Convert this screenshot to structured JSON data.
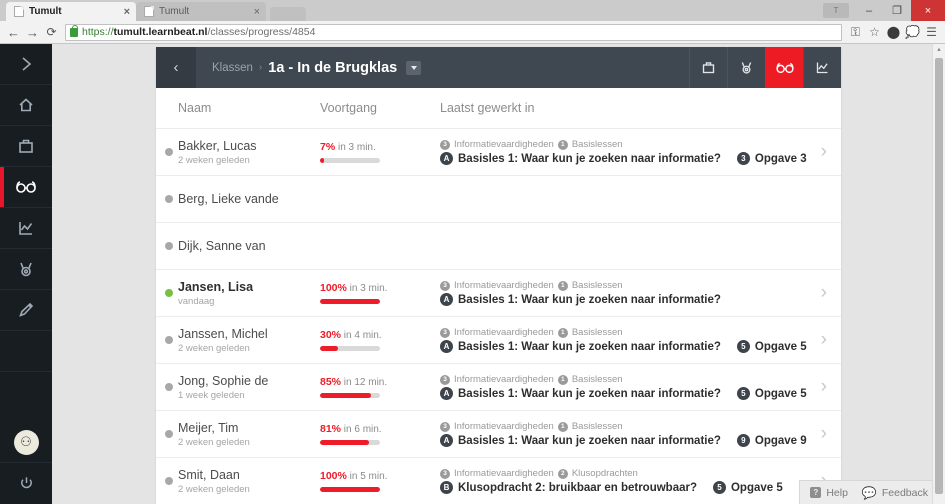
{
  "browser": {
    "tabs": [
      {
        "title": "Tumult",
        "active": true,
        "close": "×"
      },
      {
        "title": "Tumult",
        "active": false,
        "close": "×"
      }
    ],
    "window_controls": {
      "extension": "T",
      "minimize": "–",
      "maximize": "❐",
      "close": "×"
    },
    "nav": {
      "back": "←",
      "forward": "→",
      "reload": "⟳"
    },
    "url": {
      "scheme": "https://",
      "host": "tumult.learnbeat.nl",
      "path": "/classes/progress/4854"
    },
    "toolbar_icons": [
      "key-icon",
      "star-icon",
      "pocket-icon",
      "evernote-icon",
      "menu-icon"
    ]
  },
  "rail": {
    "items": [
      {
        "name": "expand-rail",
        "icon": "chevron-right-icon",
        "active": false
      },
      {
        "name": "home",
        "icon": "home-icon",
        "active": false
      },
      {
        "name": "classes",
        "icon": "briefcase-icon",
        "active": false
      },
      {
        "name": "progress",
        "icon": "glasses-icon",
        "active": true
      },
      {
        "name": "statistics",
        "icon": "chart-line-icon",
        "active": false
      },
      {
        "name": "awards",
        "icon": "medal-icon",
        "active": false
      },
      {
        "name": "editor",
        "icon": "pencil-icon",
        "active": false
      }
    ],
    "avatar_label": "⚇",
    "logout_icon": "power-icon"
  },
  "header": {
    "back_icon": "‹",
    "breadcrumb_parent": "Klassen",
    "breadcrumb_separator": "›",
    "breadcrumb_current": "1a - In de Brugklas",
    "tools": [
      {
        "name": "briefcase-icon",
        "active": false
      },
      {
        "name": "medal-icon",
        "active": false
      },
      {
        "name": "glasses-icon",
        "active": true
      },
      {
        "name": "chart-line-icon",
        "active": false
      }
    ]
  },
  "table": {
    "columns": {
      "name": "Naam",
      "progress": "Voortgang",
      "last": "Laatst gewerkt in"
    },
    "rows": [
      {
        "name": "Bakker, Lucas",
        "when": "2 weken geleden",
        "status": "grey",
        "percent": "7%",
        "percent_value": 7,
        "duration": "in 3 min.",
        "chapter_badge": "3",
        "chapter": "Informatievaardigheden",
        "section_badge": "1",
        "section": "Basislessen",
        "lesson_badge": "A",
        "lesson": "Basisles 1: Waar kun je zoeken naar informatie?",
        "task_badge": "3",
        "task": "Opgave 3",
        "highlight": false
      },
      {
        "name": "Berg, Lieke vande",
        "when": "",
        "status": "grey",
        "percent": "",
        "percent_value": 0,
        "duration": "",
        "chapter_badge": "",
        "chapter": "",
        "section_badge": "",
        "section": "",
        "lesson_badge": "",
        "lesson": "",
        "task_badge": "",
        "task": "",
        "highlight": false
      },
      {
        "name": "Dijk, Sanne van",
        "when": "",
        "status": "grey",
        "percent": "",
        "percent_value": 0,
        "duration": "",
        "chapter_badge": "",
        "chapter": "",
        "section_badge": "",
        "section": "",
        "lesson_badge": "",
        "lesson": "",
        "task_badge": "",
        "task": "",
        "highlight": false
      },
      {
        "name": "Jansen, Lisa",
        "when": "vandaag",
        "status": "green",
        "percent": "100%",
        "percent_value": 100,
        "duration": "in 3 min.",
        "chapter_badge": "3",
        "chapter": "Informatievaardigheden",
        "section_badge": "1",
        "section": "Basislessen",
        "lesson_badge": "A",
        "lesson": "Basisles 1: Waar kun je zoeken naar informatie?",
        "task_badge": "",
        "task": "",
        "highlight": true
      },
      {
        "name": "Janssen, Michel",
        "when": "2 weken geleden",
        "status": "grey",
        "percent": "30%",
        "percent_value": 30,
        "duration": "in 4 min.",
        "chapter_badge": "3",
        "chapter": "Informatievaardigheden",
        "section_badge": "1",
        "section": "Basislessen",
        "lesson_badge": "A",
        "lesson": "Basisles 1: Waar kun je zoeken naar informatie?",
        "task_badge": "5",
        "task": "Opgave 5",
        "highlight": false
      },
      {
        "name": "Jong, Sophie de",
        "when": "1 week geleden",
        "status": "grey",
        "percent": "85%",
        "percent_value": 85,
        "duration": "in 12 min.",
        "chapter_badge": "3",
        "chapter": "Informatievaardigheden",
        "section_badge": "1",
        "section": "Basislessen",
        "lesson_badge": "A",
        "lesson": "Basisles 1: Waar kun je zoeken naar informatie?",
        "task_badge": "5",
        "task": "Opgave 5",
        "highlight": false
      },
      {
        "name": "Meijer, Tim",
        "when": "2 weken geleden",
        "status": "grey",
        "percent": "81%",
        "percent_value": 81,
        "duration": "in 6 min.",
        "chapter_badge": "3",
        "chapter": "Informatievaardigheden",
        "section_badge": "1",
        "section": "Basislessen",
        "lesson_badge": "A",
        "lesson": "Basisles 1: Waar kun je zoeken naar informatie?",
        "task_badge": "9",
        "task": "Opgave 9",
        "highlight": false
      },
      {
        "name": "Smit, Daan",
        "when": "2 weken geleden",
        "status": "grey",
        "percent": "100%",
        "percent_value": 100,
        "duration": "in 5 min.",
        "chapter_badge": "3",
        "chapter": "Informatievaardigheden",
        "section_badge": "2",
        "section": "Klusopdrachten",
        "lesson_badge": "B",
        "lesson": "Klusopdracht 2: bruikbaar en betrouwbaar?",
        "task_badge": "5",
        "task": "Opgave 5",
        "highlight": false
      }
    ]
  },
  "helpbar": {
    "help_label": "Help",
    "help_icon": "?",
    "feedback_label": "Feedback",
    "feedback_icon": "✦"
  },
  "colors": {
    "accent_red": "#ed1c24",
    "header_dark": "#3f4750",
    "rail_dark": "#181d22",
    "status_green": "#77c043",
    "page_bg": "#e4e4e4"
  }
}
